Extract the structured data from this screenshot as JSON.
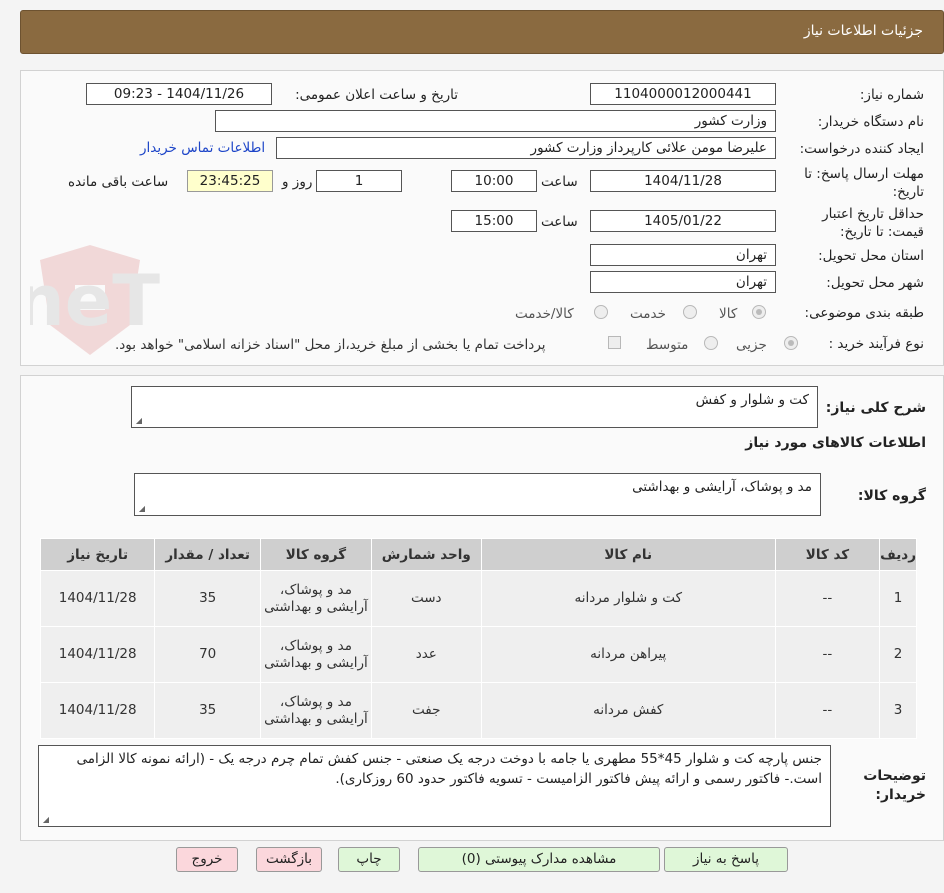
{
  "header": {
    "title": "جزئيات اطلاعات نیاز"
  },
  "watermark": {
    "text": "AriaTender.neT"
  },
  "form": {
    "need_number": {
      "label": "شماره نیاز:",
      "value": "1104000012000441"
    },
    "announce_datetime": {
      "label": "تاریخ و ساعت اعلان عمومی:",
      "value": "1404/11/26 - 09:23"
    },
    "buyer_org": {
      "label": "نام دستگاه خریدار:",
      "value": "وزارت کشور"
    },
    "requester": {
      "label": "ایجاد کننده درخواست:",
      "value": "علیرضا مومن علائی کارپرداز وزارت کشور",
      "contact_link": "اطلاعات تماس خریدار"
    },
    "response_deadline": {
      "label": "مهلت ارسال پاسخ: تا تاریخ:",
      "date": "1404/11/28",
      "time_label": "ساعت",
      "time": "10:00",
      "days": "1",
      "days_label": "روز و",
      "remaining": "23:45:25",
      "remaining_label": "ساعت باقی مانده"
    },
    "price_validity": {
      "label": "حداقل تاریخ اعتبار قیمت: تا تاریخ:",
      "date": "1405/01/22",
      "time_label": "ساعت",
      "time": "15:00"
    },
    "delivery_province": {
      "label": "استان محل تحویل:",
      "value": "تهران"
    },
    "delivery_city": {
      "label": "شهر محل تحویل:",
      "value": "تهران"
    },
    "category": {
      "label": "طبقه بندی موضوعی:",
      "options": [
        "کالا",
        "خدمت",
        "کالا/خدمت"
      ],
      "selected": "کالا"
    },
    "purchase_process": {
      "label": "نوع فرآیند خرید :",
      "options": [
        "جزیی",
        "متوسط"
      ],
      "selected": "جزیی",
      "note": "پرداخت تمام یا بخشی از مبلغ خرید،از محل \"اسناد خزانه اسلامی\" خواهد بود."
    }
  },
  "summary": {
    "label": "شرح کلی نیاز:",
    "value": "کت و شلوار و کفش"
  },
  "goods_section": {
    "title": "اطلاعات کالاهای مورد نیاز",
    "group_label": "گروه کالا:",
    "group_value": "مد و پوشاک، آرایشی و بهداشتی"
  },
  "table": {
    "columns": [
      "ردیف",
      "کد کالا",
      "نام کالا",
      "واحد شمارش",
      "گروه کالا",
      "تعداد / مقدار",
      "تاریخ نیاز"
    ],
    "rows": [
      [
        "1",
        "--",
        "کت و شلوار مردانه",
        "دست",
        "مد و پوشاک، آرایشی و بهداشتی",
        "35",
        "1404/11/28"
      ],
      [
        "2",
        "--",
        "پیراهن مردانه",
        "عدد",
        "مد و پوشاک، آرایشی و بهداشتی",
        "70",
        "1404/11/28"
      ],
      [
        "3",
        "--",
        "کفش مردانه",
        "جفت",
        "مد و پوشاک، آرایشی و بهداشتی",
        "35",
        "1404/11/28"
      ]
    ]
  },
  "buyer_notes": {
    "label": "توضیحات خریدار:",
    "value": "جنس پارچه کت و شلوار 45*55 مطهری یا جامه با دوخت درجه یک صنعتی - جنس کفش تمام چرم درجه یک - (ارائه نمونه کالا الزامی است.- فاکتور رسمی و ارائه پیش فاکتور الزامیست - تسویه فاکتور حدود 60 روزکاری)."
  },
  "buttons": {
    "reply": "پاسخ به نیاز",
    "attachments": "مشاهده مدارک پیوستی (0)",
    "print": "چاپ",
    "back": "بازگشت",
    "exit": "خروج"
  }
}
